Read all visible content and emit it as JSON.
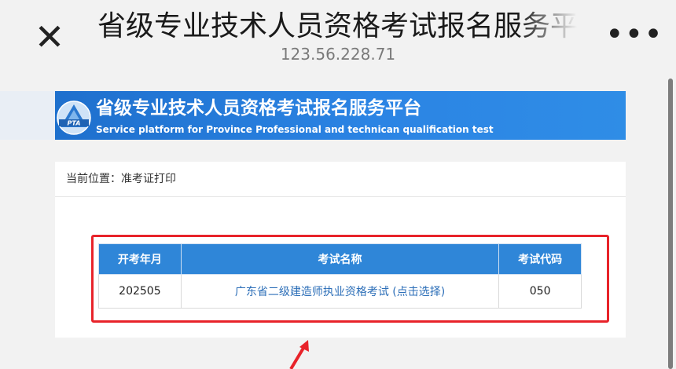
{
  "browser": {
    "title": "省级专业技术人员资格考试报名服务平台",
    "url": "123.56.228.71",
    "close_glyph": "✕",
    "more_glyph": "•••"
  },
  "banner": {
    "logo_text": "PTA",
    "title_cn": "省级专业技术人员资格考试报名服务平台",
    "title_en": "Service platform for Province Professional and technican qualification test"
  },
  "breadcrumb": "当前位置：准考证打印",
  "table": {
    "headers": [
      "开考年月",
      "考试名称",
      "考试代码"
    ],
    "rows": [
      {
        "month": "202505",
        "name": "广东省二级建造师执业资格考试 (点击选择)",
        "code": "050"
      }
    ]
  },
  "colors": {
    "banner": "#2b84e4",
    "table_header": "#2f86d8",
    "link": "#2d6fb8",
    "annotation": "#e8232a"
  }
}
